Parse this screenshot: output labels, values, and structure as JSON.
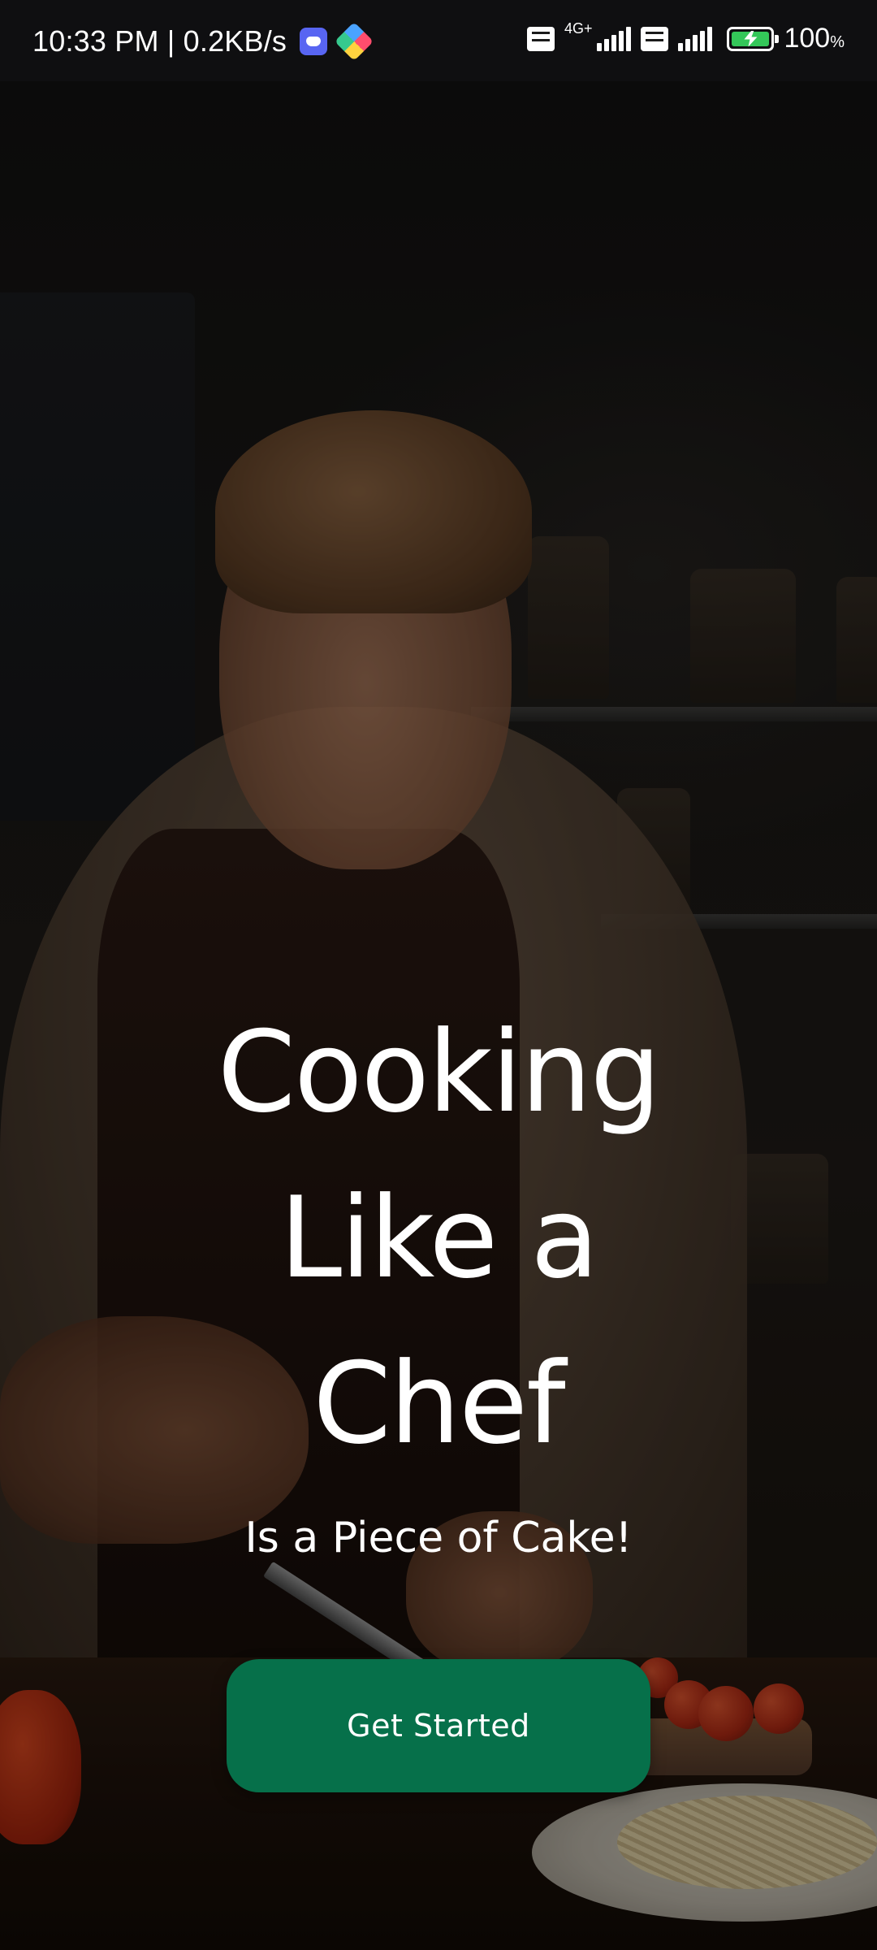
{
  "status_bar": {
    "time_speed": "10:33 PM | 0.2KB/s",
    "network_type": "4G+",
    "battery_percent": "100",
    "battery_unit": "%",
    "icons": [
      "discord-icon",
      "photos-icon",
      "volte-icon",
      "signal-icon",
      "volte-icon",
      "signal-icon",
      "battery-charging-icon"
    ]
  },
  "hero": {
    "title_lines": [
      "Cooking",
      "Like a",
      "Chef"
    ],
    "subtitle": "Is a Piece of Cake!"
  },
  "cta": {
    "label": "Get Started"
  },
  "colors": {
    "button_bg": "#06704a",
    "text": "#ffffff",
    "status_bar_bg": "#101012"
  }
}
